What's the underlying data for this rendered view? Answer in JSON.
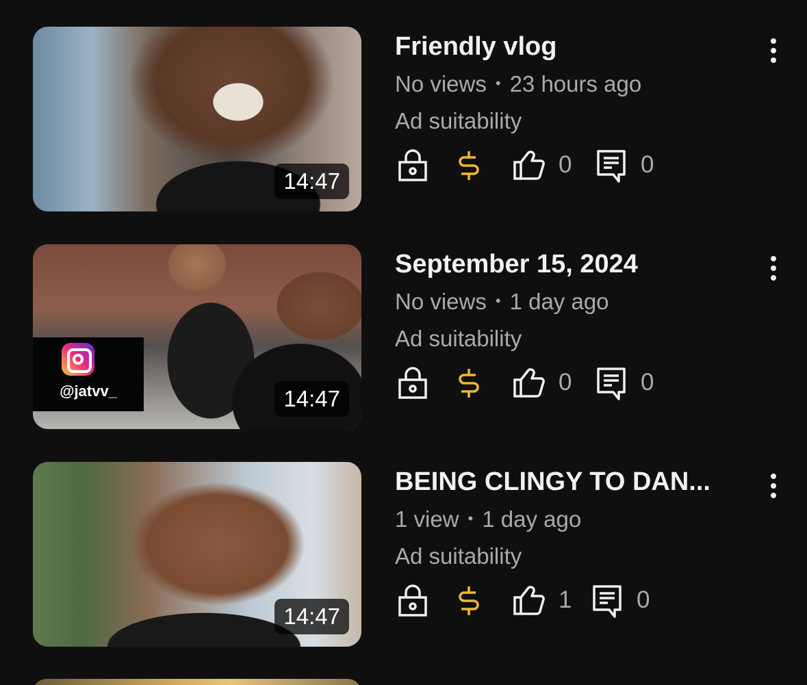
{
  "videos": [
    {
      "title": "Friendly vlog",
      "views": "No views",
      "separator": "•",
      "age": "23 hours ago",
      "ad_label": "Ad suitability",
      "duration": "14:47",
      "likes": "0",
      "comments": "0"
    },
    {
      "title": "September 15, 2024",
      "views": "No views",
      "separator": "•",
      "age": "1 day ago",
      "ad_label": "Ad suitability",
      "duration": "14:47",
      "likes": "0",
      "comments": "0",
      "thumbnail_overlay": "@jatvv_"
    },
    {
      "title": "BEING CLINGY TO DAN...",
      "views": "1 view",
      "separator": "•",
      "age": "1 day ago",
      "ad_label": "Ad suitability",
      "duration": "14:47",
      "likes": "1",
      "comments": "0"
    }
  ],
  "icons": {
    "visibility": "lock-icon",
    "monetization": "dollar-icon",
    "likes": "thumbs-up-icon",
    "comments": "comment-icon",
    "menu": "more-vertical-icon"
  },
  "colors": {
    "background": "#0f0f0f",
    "text_primary": "#f1f1f1",
    "text_secondary": "#aaaaaa",
    "monetization_accent": "#f5b82e"
  }
}
